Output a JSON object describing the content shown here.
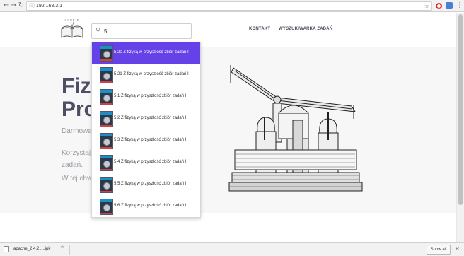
{
  "browser": {
    "url": "192.168.3.1",
    "back_icon": "arrow-left-icon",
    "forward_icon": "arrow-right-icon",
    "reload_icon": "reload-icon",
    "info_icon": "info-icon",
    "star_icon": "star-icon"
  },
  "header": {
    "logo_text": "CURRIE",
    "search_value": "5",
    "nav": [
      "KONTAKT",
      "WYSZUKIWARKA ZADAŃ"
    ]
  },
  "hero": {
    "title_line1": "Fizy",
    "title_line2": "Pro",
    "subtitle": "Darmowa",
    "text_line1": "Korzystaj",
    "text_line2": "zadań.",
    "text_line3": "W tej chw"
  },
  "dropdown": {
    "active_index": 0,
    "items": [
      "5.20 Z fizyką w przyszłość zbiór zadań I",
      "5.21 Z fizyką w przyszłość zbiór zadań I",
      "5.1 Z fizyką w przyszłość zbiór zadań I",
      "5.2 Z fizyką w przyszłość zbiór zadań I",
      "5.3 Z fizyką w przyszłość zbiór zadań I",
      "5.4 Z fizyką w przyszłość zbiór zadań I",
      "5.5 Z fizyką w przyszłość zbiór zadań I",
      "5.6 Z fizyką w przyszłość zbiór zadań I"
    ]
  },
  "downloads": {
    "file_name": "apache_2.4.2.....ipk",
    "show_all_label": "Show all"
  },
  "colors": {
    "accent": "#6541e8",
    "title": "#4d4d63"
  }
}
